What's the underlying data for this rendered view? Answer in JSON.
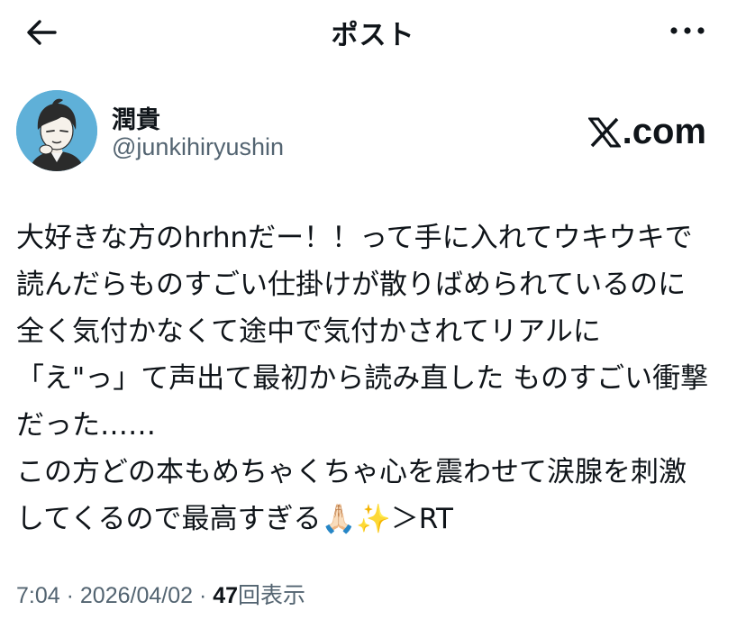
{
  "header": {
    "title": "ポスト",
    "back_icon": "back-arrow-icon",
    "more_icon": "more-dots-icon"
  },
  "author": {
    "display_name": "潤貴",
    "handle": "@junkihiryushin",
    "avatar_color": "#5fb0d8"
  },
  "source": {
    "label": ".com",
    "logo": "x-logo-icon"
  },
  "post": {
    "lines": [
      "大好きな方のhrhnだー！！って手に入れてウキウキで",
      "読んだらものすごい仕掛けが散りばめられているのに",
      "全く気付かなくて途中で気付かされてリアルに",
      "「え\"っ」て声出て最初から読み直した ものすごい衝撃",
      "だった……",
      "この方どの本もめちゃくちゃ心を震わせて涙腺を刺激",
      "してくるので最高すぎる🙏🏻✨＞RT"
    ]
  },
  "meta": {
    "time": "7:04",
    "separator": " · ",
    "date": "2026/04/02",
    "views_count": "47",
    "views_label": "回表示"
  }
}
